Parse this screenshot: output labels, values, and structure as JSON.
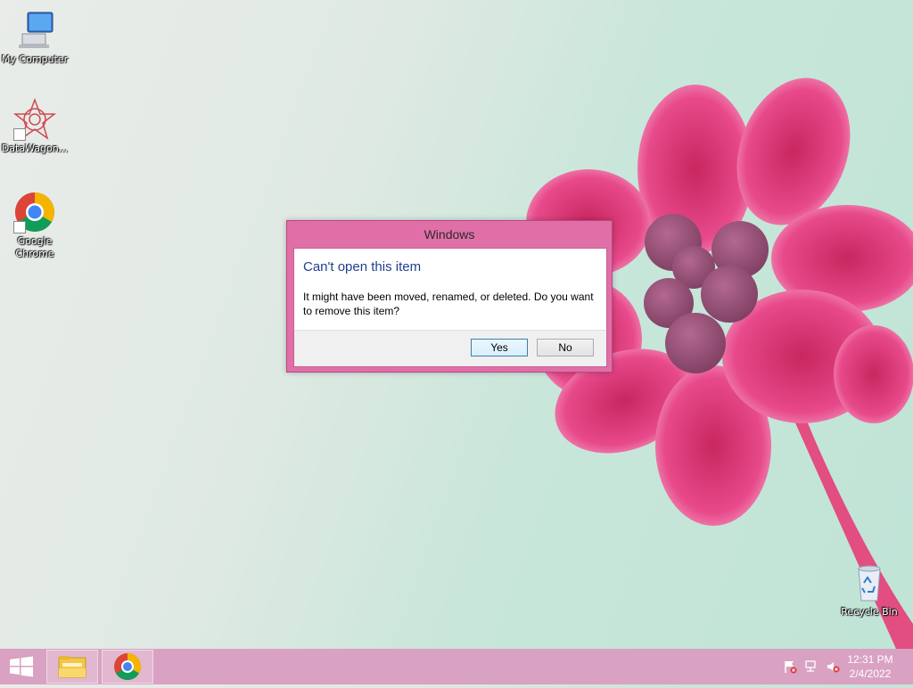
{
  "desktop": {
    "icons": [
      {
        "label": "My Computer",
        "icon": "computer-icon"
      },
      {
        "label": "DataWagon...",
        "icon": "datawagon-icon"
      },
      {
        "label": "Google Chrome",
        "icon": "chrome-icon"
      },
      {
        "label": "Recycle Bin",
        "icon": "recycle-bin-icon"
      }
    ]
  },
  "dialog": {
    "title": "Windows",
    "heading": "Can't open this item",
    "message": "It might have been moved, renamed, or deleted. Do you want to remove this item?",
    "yes_label": "Yes",
    "no_label": "No"
  },
  "taskbar": {
    "start_icon": "windows-logo-icon",
    "pinned": [
      {
        "icon": "file-explorer-icon"
      },
      {
        "icon": "chrome-icon"
      }
    ],
    "tray": [
      {
        "icon": "action-center-flag-icon"
      },
      {
        "icon": "network-icon"
      },
      {
        "icon": "volume-muted-icon"
      }
    ],
    "time": "12:31 PM",
    "date": "2/4/2022"
  },
  "colors": {
    "dialog_frame": "#e06fa8",
    "taskbar": "#d9a1c2",
    "heading_text": "#1f3f8f",
    "flower": "#e0407f"
  }
}
